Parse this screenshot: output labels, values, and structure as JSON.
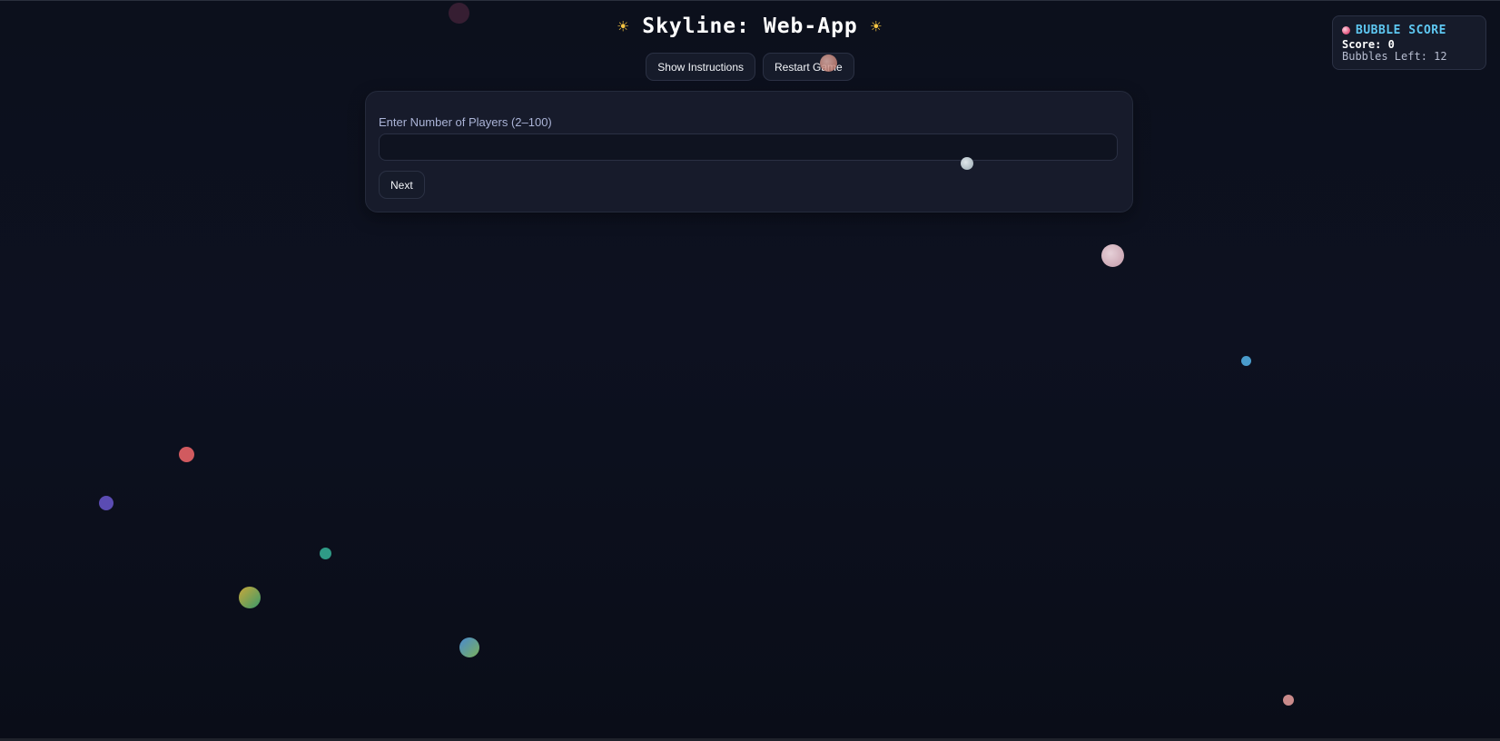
{
  "header": {
    "title": "Skyline: Web-App",
    "left_icon": "☀",
    "right_icon": "☀"
  },
  "toolbar": {
    "instructions_label": "Show Instructions",
    "restart_label": "Restart Game"
  },
  "setup": {
    "label": "Enter Number of Players (2–100)",
    "input_value": "",
    "next_label": "Next"
  },
  "score_panel": {
    "title": "BUBBLE SCORE",
    "score_text": "Score: 0",
    "bubbles_left_text": "Bubbles Left: 12"
  },
  "colors": {
    "background": "#0c101c",
    "accent": "#5ec8f2",
    "sun": "#f5c542"
  }
}
